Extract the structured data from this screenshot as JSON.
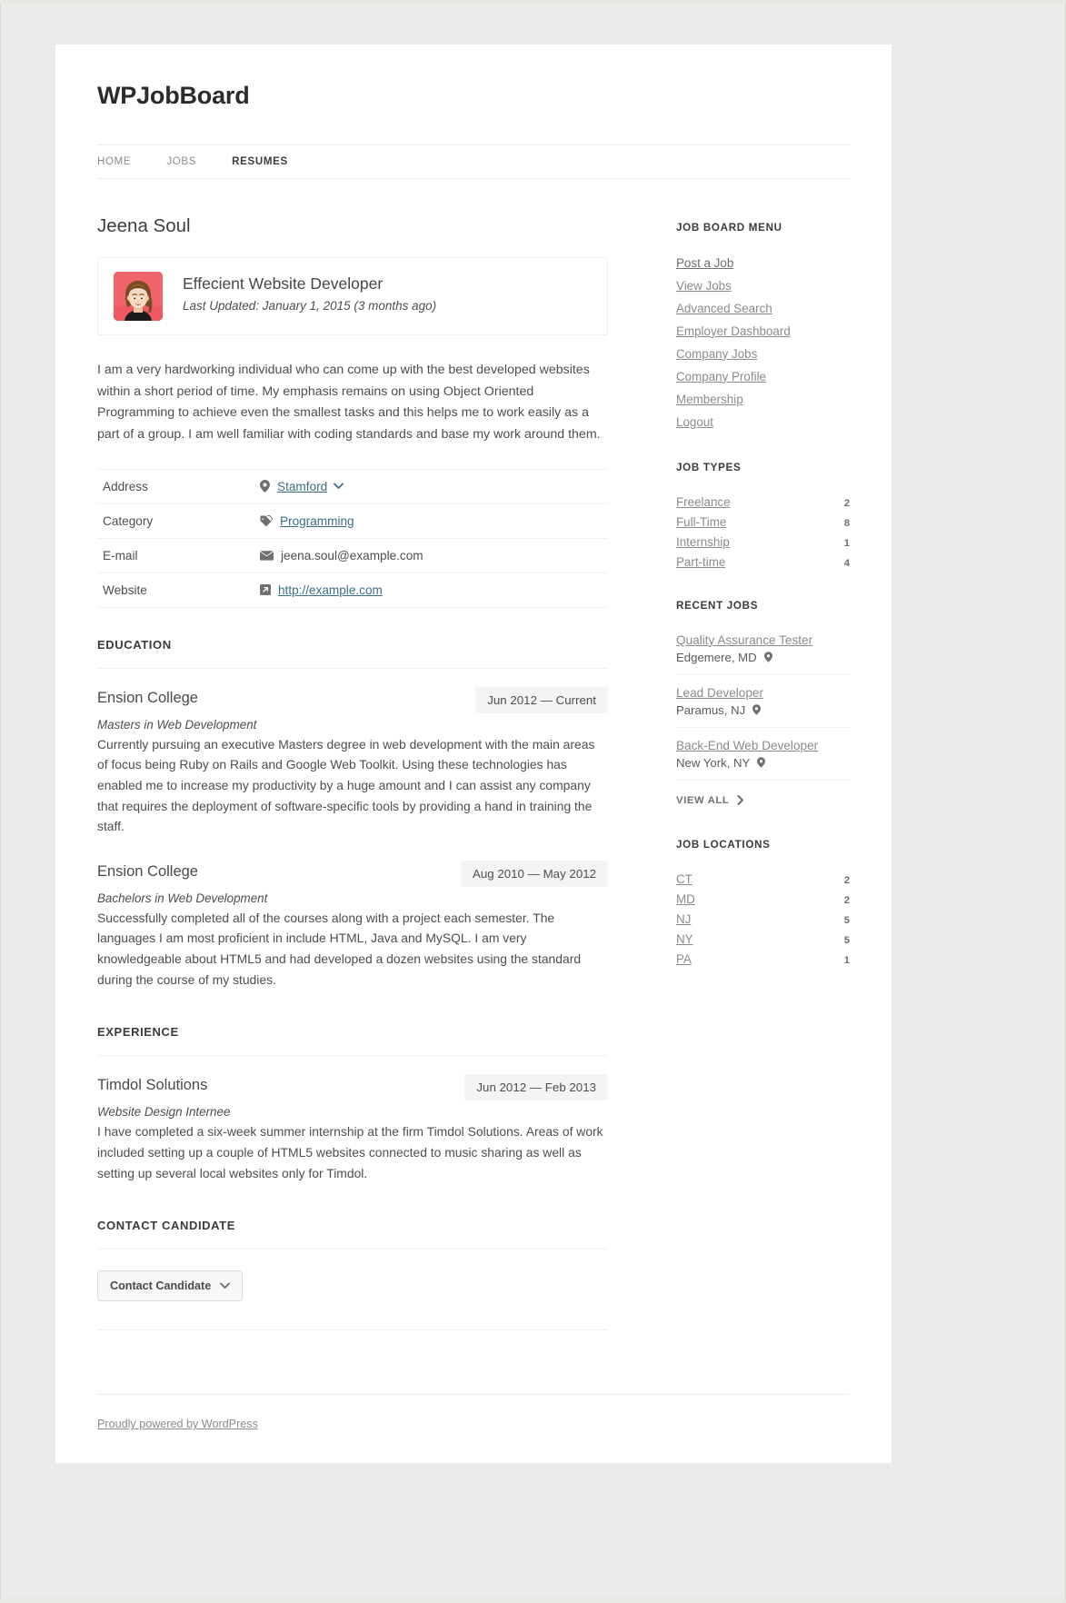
{
  "site": {
    "title": "WPJobBoard",
    "nav": [
      {
        "label": "HOME",
        "active": false
      },
      {
        "label": "JOBS",
        "active": false
      },
      {
        "label": "RESUMES",
        "active": true
      }
    ],
    "footer_text": "Proudly powered by WordPress"
  },
  "resume": {
    "candidate_name": "Jeena Soul",
    "role": "Effecient Website Developer",
    "last_updated": "Last Updated: January 1, 2015 (3 months ago)",
    "summary": "I am a very hardworking individual who can come up with the best developed websites within a short period of time. My emphasis remains on using Object Oriented Programming to achieve even the smallest tasks and this helps me to work easily as a part of a group. I am well familiar with coding standards and base my work around them.",
    "details": [
      {
        "label": "Address",
        "value": "Stamford",
        "icon": "map-pin-icon",
        "link": true,
        "caret": true
      },
      {
        "label": "Category",
        "value": "Programming",
        "icon": "tag-icon",
        "link": true,
        "caret": false
      },
      {
        "label": "E-mail",
        "value": "jeena.soul@example.com",
        "icon": "envelope-icon",
        "link": false,
        "caret": false
      },
      {
        "label": "Website",
        "value": "http://example.com",
        "icon": "external-link-icon",
        "link": true,
        "caret": false
      }
    ],
    "education_heading": "EDUCATION",
    "education": [
      {
        "org": "Ension College",
        "date": "Jun 2012 — Current",
        "sub": "Masters in Web Development",
        "desc": "Currently pursuing an executive Masters degree in web development with the main areas of focus being Ruby on Rails and Google Web Toolkit. Using these technologies has enabled me to increase my productivity by a huge amount and I can assist any company that requires the deployment of software-specific tools by providing a hand in training the staff."
      },
      {
        "org": "Ension College",
        "date": "Aug 2010 — May 2012",
        "sub": "Bachelors in Web Development",
        "desc": "Successfully completed all of the courses along with a project each semester. The languages I am most proficient in include HTML, Java and MySQL. I am very knowledgeable about HTML5 and had developed a dozen websites using the standard during the course of my studies."
      }
    ],
    "experience_heading": "EXPERIENCE",
    "experience": [
      {
        "org": "Timdol Solutions",
        "date": "Jun 2012 — Feb 2013",
        "sub": "Website Design Internee",
        "desc": "I have completed a six-week summer internship at the firm Timdol Solutions. Areas of work included setting up a couple of HTML5 websites connected to music sharing as well as setting up several local websites only for Timdol."
      }
    ],
    "contact_heading": "CONTACT CANDIDATE",
    "contact_button_label": "Contact Candidate"
  },
  "sidebar": {
    "job_board_menu": {
      "title": "JOB BOARD MENU",
      "items": [
        {
          "label": "Post a Job"
        },
        {
          "label": "View Jobs"
        },
        {
          "label": "Advanced Search"
        },
        {
          "label": "Employer Dashboard"
        },
        {
          "label": "Company Jobs"
        },
        {
          "label": "Company Profile"
        },
        {
          "label": "Membership"
        },
        {
          "label": "Logout"
        }
      ]
    },
    "job_types": {
      "title": "JOB TYPES",
      "items": [
        {
          "label": "Freelance",
          "count": "2"
        },
        {
          "label": "Full-Time",
          "count": "8"
        },
        {
          "label": "Internship",
          "count": "1"
        },
        {
          "label": "Part-time",
          "count": "4"
        }
      ]
    },
    "recent_jobs": {
      "title": "RECENT JOBS",
      "items": [
        {
          "title": "Quality Assurance Tester",
          "location": "Edgemere, MD"
        },
        {
          "title": "Lead Developer",
          "location": "Paramus, NJ"
        },
        {
          "title": "Back-End Web Developer",
          "location": "New York, NY"
        }
      ],
      "view_all_label": "VIEW ALL"
    },
    "job_locations": {
      "title": "JOB LOCATIONS",
      "items": [
        {
          "label": "CT",
          "count": "2"
        },
        {
          "label": "MD",
          "count": "2"
        },
        {
          "label": "NJ",
          "count": "5"
        },
        {
          "label": "NY",
          "count": "5"
        },
        {
          "label": "PA",
          "count": "1"
        }
      ]
    }
  },
  "colors": {
    "link": "#3a6f83",
    "avatar_bg": "#f0636a",
    "page_bg": "#ebebeb"
  }
}
